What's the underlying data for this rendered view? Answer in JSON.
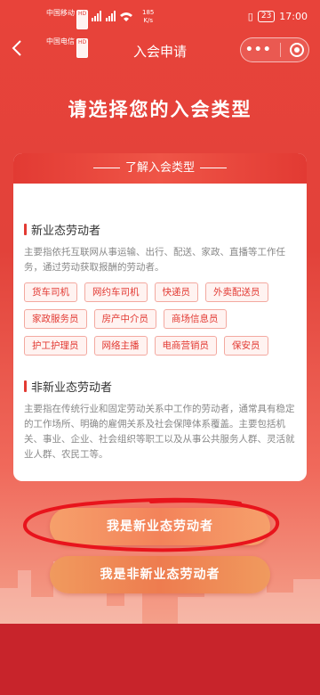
{
  "status_bar": {
    "carrier1": "中国移动",
    "carrier1_tag": "HD",
    "carrier2": "中国电信",
    "carrier2_tag": "HD",
    "signal": "⁴⁶ᵢₗ ⁴⁶ᵢₗ",
    "net_speed_value": "185",
    "net_speed_unit": "K/s",
    "battery": "23",
    "time": "17:00"
  },
  "nav": {
    "back_glyph": "‹",
    "title": "入会申请",
    "more_glyph": "•••"
  },
  "heading": "请选择您的入会类型",
  "card": {
    "header": "了解入会类型",
    "new_section": {
      "title": "新业态劳动者",
      "desc": "主要指依托互联网从事运输、出行、配送、家政、直播等工作任务，通过劳动获取报酬的劳动者。",
      "tags": [
        "货车司机",
        "网约车司机",
        "快递员",
        "外卖配送员",
        "家政服务员",
        "房产中介员",
        "商场信息员",
        "护工护理员",
        "网络主播",
        "电商营销员",
        "保安员"
      ]
    },
    "non_section": {
      "title": "非新业态劳动者",
      "desc": "主要指在传统行业和固定劳动关系中工作的劳动者，通常具有稳定的工作场所、明确的雇佣关系及社会保障体系覆盖。主要包括机关、事业、企业、社会组织等职工以及从事公共服务人群、灵活就业人群、农民工等。"
    }
  },
  "buttons": {
    "new_worker": "我是新业态劳动者",
    "non_new_worker": "我是非新业态劳动者"
  },
  "colors": {
    "primary_red": "#e23a33",
    "button_orange": "#f3835a",
    "annotation_red": "#e8141c"
  }
}
